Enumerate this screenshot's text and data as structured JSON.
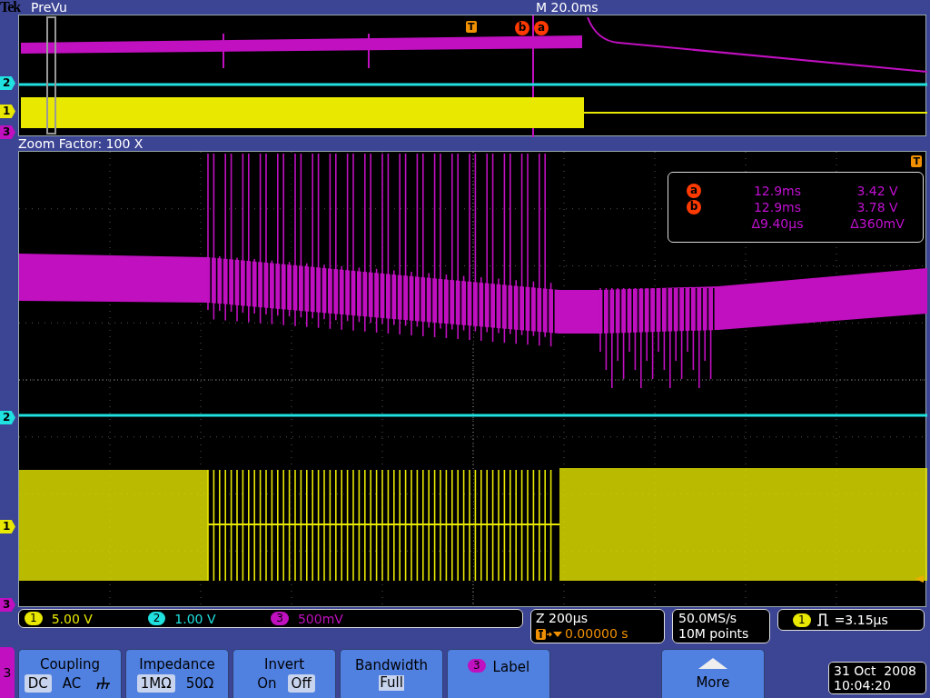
{
  "header": {
    "brand": "Tek",
    "mode": "PreVu",
    "timebase": "M 20.0ms"
  },
  "preview": {
    "markers": [
      {
        "label": "2",
        "color": "#20e0e0"
      },
      {
        "label": "1",
        "color": "#e8e800"
      },
      {
        "label": "3",
        "color": "#c010c0"
      }
    ],
    "trigger_marker": "T",
    "cursor_markers": [
      "b",
      "a"
    ]
  },
  "zoom_factor": "Zoom Factor: 100 X",
  "readout": {
    "cursors": [
      {
        "label": "a",
        "time": "12.9ms",
        "value": "3.42 V"
      },
      {
        "label": "b",
        "time": "12.9ms",
        "value": "3.78 V"
      }
    ],
    "delta": {
      "time": "Δ9.40µs",
      "value": "Δ360mV"
    }
  },
  "main": {
    "markers": [
      {
        "label": "2",
        "color": "#20e0e0"
      },
      {
        "label": "1",
        "color": "#e8e800"
      },
      {
        "label": "3",
        "color": "#c010c0"
      }
    ],
    "trigger_marker": "T"
  },
  "channels": [
    {
      "number": "1",
      "scale": "5.00 V",
      "color": "#e8e800"
    },
    {
      "number": "2",
      "scale": "1.00 V",
      "color": "#20e0e0"
    },
    {
      "number": "3",
      "scale": "500mV",
      "color": "#c010c0"
    }
  ],
  "zoom": {
    "scale": "Z 200µs",
    "position": "0.00000 s"
  },
  "acquisition": {
    "rate": "50.0MS/s",
    "record": "10M points"
  },
  "trigger": {
    "channel": "1",
    "value": "=3.15µs"
  },
  "menu": {
    "channel": "3",
    "buttons": [
      {
        "kind": "options",
        "title": "Coupling",
        "options": [
          {
            "kind": "text",
            "label": "DC",
            "selected": true
          },
          {
            "kind": "text",
            "label": "AC",
            "selected": false
          },
          {
            "kind": "ground",
            "selected": false
          }
        ]
      },
      {
        "kind": "options",
        "title": "Impedance",
        "options": [
          {
            "kind": "text",
            "label": "1MΩ",
            "selected": true
          },
          {
            "kind": "text",
            "label": "50Ω",
            "selected": false
          }
        ]
      },
      {
        "kind": "options",
        "title": "Invert",
        "options": [
          {
            "kind": "text",
            "label": "On",
            "selected": false
          },
          {
            "kind": "text",
            "label": "Off",
            "selected": true
          }
        ]
      },
      {
        "kind": "value",
        "title": "Bandwidth",
        "value": "Full"
      },
      {
        "kind": "label",
        "badge": "3",
        "title": "Label"
      },
      {
        "kind": "more",
        "title": "More"
      }
    ]
  },
  "date": {
    "day": "31 Oct  2008",
    "time": "10:04:20"
  }
}
